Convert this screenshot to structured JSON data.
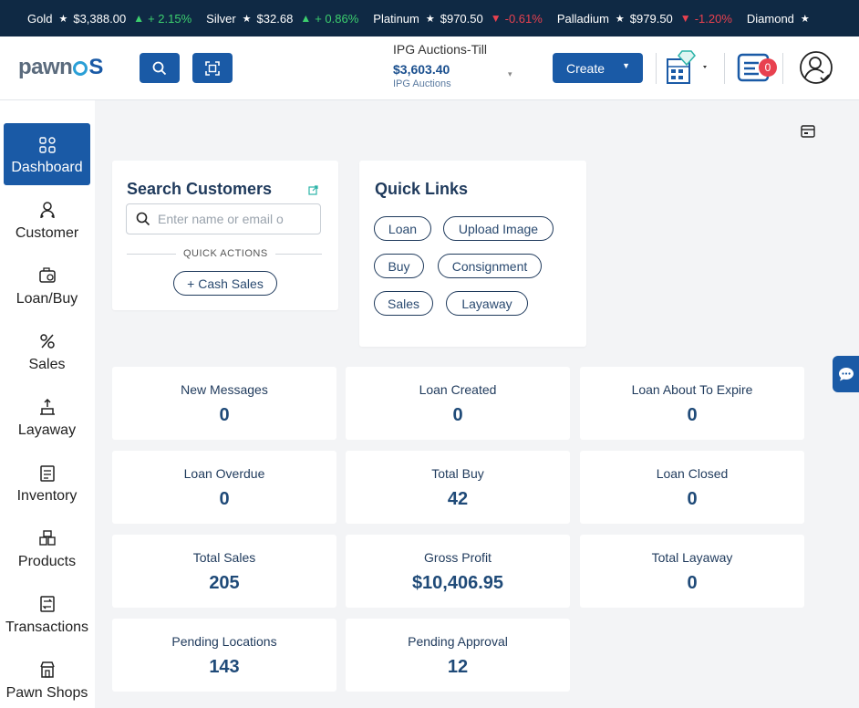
{
  "ticker": [
    {
      "name": "Gold",
      "price": "$3,388.00",
      "dir": "up",
      "arrow": "▲",
      "change": "+ 2.15%"
    },
    {
      "name": "Silver",
      "price": "$32.68",
      "dir": "up",
      "arrow": "▲",
      "change": "+ 0.86%"
    },
    {
      "name": "Platinum",
      "price": "$970.50",
      "dir": "down",
      "arrow": "▼",
      "change": "-0.61%"
    },
    {
      "name": "Palladium",
      "price": "$979.50",
      "dir": "down",
      "arrow": "▼",
      "change": "-1.20%"
    },
    {
      "name": "Diamond",
      "price": "",
      "dir": "",
      "arrow": "",
      "change": ""
    }
  ],
  "header": {
    "logo_text": "pawn",
    "logo_suffix": "S",
    "till_name": "IPG Auctions-Till",
    "till_amount": "$3,603.40",
    "till_location": "IPG Auctions",
    "create_label": "Create",
    "notification_count": "0"
  },
  "sidebar": {
    "items": [
      {
        "label": "Dashboard",
        "icon": "dashboard-icon"
      },
      {
        "label": "Customer",
        "icon": "customer-icon"
      },
      {
        "label": "Loan/Buy",
        "icon": "loan-icon"
      },
      {
        "label": "Sales",
        "icon": "sales-icon"
      },
      {
        "label": "Layaway",
        "icon": "layaway-icon"
      },
      {
        "label": "Inventory",
        "icon": "inventory-icon"
      },
      {
        "label": "Products",
        "icon": "products-icon"
      },
      {
        "label": "Transactions",
        "icon": "transactions-icon"
      },
      {
        "label": "Pawn Shops",
        "icon": "pawn-shops-icon"
      }
    ]
  },
  "search_customers": {
    "title": "Search Customers",
    "placeholder": "Enter name or email o",
    "quick_actions_label": "QUICK ACTIONS",
    "cash_sales_label": "+ Cash Sales"
  },
  "quick_links": {
    "title": "Quick Links",
    "links": [
      "Loan",
      "Upload Image",
      "Buy",
      "Consignment",
      "Sales",
      "Layaway"
    ]
  },
  "stats": [
    {
      "label": "New Messages",
      "value": "0"
    },
    {
      "label": "Loan Created",
      "value": "0"
    },
    {
      "label": "Loan About To Expire",
      "value": "0"
    },
    {
      "label": "Loan Overdue",
      "value": "0"
    },
    {
      "label": "Total Buy",
      "value": "42"
    },
    {
      "label": "Loan Closed",
      "value": "0"
    },
    {
      "label": "Total Sales",
      "value": "205"
    },
    {
      "label": "Gross Profit",
      "value": "$10,406.95"
    },
    {
      "label": "Total Layaway",
      "value": "0"
    },
    {
      "label": "Pending Locations",
      "value": "143"
    },
    {
      "label": "Pending Approval",
      "value": "12"
    }
  ],
  "colors": {
    "ticker_bg": "#0f2944",
    "primary": "#1a5aa6",
    "up": "#3ccf6e",
    "down": "#e8414f"
  }
}
